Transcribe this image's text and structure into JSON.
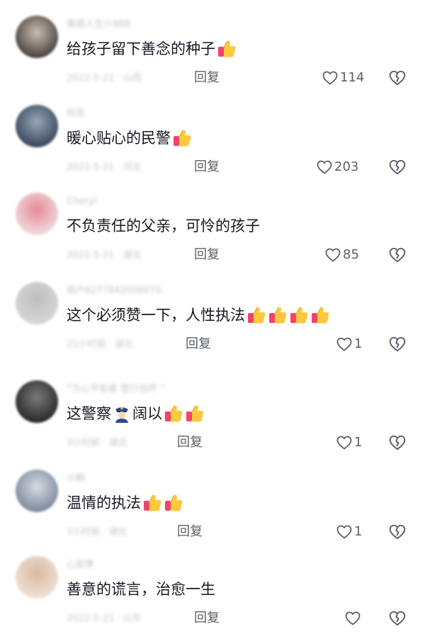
{
  "comments": [
    {
      "username": "美丽人生小888",
      "text": "给孩子留下善念的种子",
      "thumbs": 1,
      "police": false,
      "meta": "2022-5-21 · 山西",
      "reply_label": "回复",
      "likes": "114",
      "avatar_colors": [
        "#3a3230",
        "#c9bdb2"
      ]
    },
    {
      "username": "阿苏",
      "text": "暖心贴心的民警",
      "thumbs": 1,
      "police": false,
      "meta": "2022-5-21 · 河北",
      "reply_label": "回复",
      "likes": "203",
      "avatar_colors": [
        "#2b3a52",
        "#9aa6b6"
      ]
    },
    {
      "username": "Cheryl",
      "text": "不负责任的父亲，可怜的孩子",
      "thumbs": 0,
      "police": false,
      "meta": "2022-5-21 · 湖北",
      "reply_label": "回复",
      "likes": "85",
      "avatar_colors": [
        "#f3e4e6",
        "#e58b98"
      ]
    },
    {
      "username": "用户6277842006075",
      "text": "这个必须赞一下，人性执法",
      "thumbs": 4,
      "police": false,
      "meta": "21小时前 · 湖北",
      "reply_label": "回复",
      "likes": "1",
      "avatar_colors": [
        "#d9d9d9",
        "#bfbfbf"
      ]
    },
    {
      "username": "“万心平安者 签行也坏 ”",
      "text": "这警察",
      "text_after": "阔以",
      "thumbs": 2,
      "police": true,
      "meta": "3小时前 · 湖北",
      "reply_label": "回复",
      "likes": "1",
      "avatar_colors": [
        "#1e1e1e",
        "#7a7a7a"
      ]
    },
    {
      "username": "小韩",
      "text": "温情的执法",
      "thumbs": 2,
      "police": false,
      "meta": "3小时前 · 湖北",
      "reply_label": "回复",
      "likes": "1",
      "avatar_colors": [
        "#6f7f94",
        "#d8dbe2"
      ]
    },
    {
      "username": "心如李",
      "text": "善意的谎言，治愈一生",
      "thumbs": 0,
      "police": false,
      "meta": "2022-5-21 · 山东",
      "reply_label": "回复",
      "likes": "",
      "avatar_colors": [
        "#f1e6dc",
        "#d8b9a0"
      ]
    }
  ],
  "colors": {
    "text_primary": "#161823",
    "text_secondary": "#5c5f69",
    "text_muted": "#c3c5cc",
    "thumb_yellow": "#ffc83d",
    "thumb_red": "#f0446a"
  },
  "icons": {
    "like": "heart-outline-icon",
    "dislike": "broken-heart-outline-icon",
    "emoji": "thumbs-up-emoji",
    "police": "police-officer-emoji"
  }
}
